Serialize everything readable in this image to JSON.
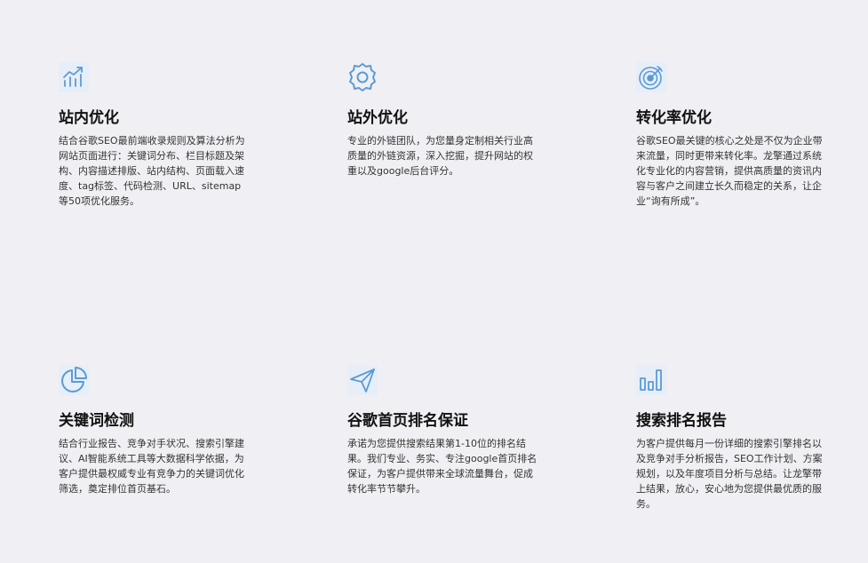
{
  "colors": {
    "background": "#f0f0f4",
    "icon_blue": "#5b9bd5",
    "icon_bg": "#e6eef8"
  },
  "cards": [
    {
      "icon": "trend-chart-icon",
      "title": "站内优化",
      "desc": "结合谷歌SEO最前端收录规则及算法分析为网站页面进行：关键词分布、栏目标题及架构、内容描述排版、站内结构、页面载入速度、tag标签、代码检测、URL、sitemap等50项优化服务。"
    },
    {
      "icon": "gear-icon",
      "title": "站外优化",
      "desc": "专业的外链团队，为您量身定制相关行业高质量的外链资源，深入挖掘，提升网站的权重以及google后台评分。"
    },
    {
      "icon": "target-icon",
      "title": "转化率优化",
      "desc": "谷歌SEO最关键的核心之处是不仅为企业带来流量，同时更带来转化率。龙擎通过系统化专业化的内容营销，提供高质量的资讯内容与客户之间建立长久而稳定的关系，让企业“询有所成”。"
    },
    {
      "icon": "pie-chart-icon",
      "title": "关键词检测",
      "desc": "结合行业报告、竞争对手状况、搜索引擎建议、AI智能系统工具等大数据科学依据，为客户提供最权威专业有竞争力的关键词优化筛选，奠定排位首页基石。"
    },
    {
      "icon": "paper-plane-icon",
      "title": "谷歌首页排名保证",
      "desc": "承诺为您提供搜索结果第1-10位的排名结果。我们专业、务实、专注google首页排名保证，为客户提供带来全球流量舞台，促成转化率节节攀升。"
    },
    {
      "icon": "bar-chart-icon",
      "title": "搜索排名报告",
      "desc": "为客户提供每月一份详细的搜索引擎排名以及竞争对手分析报告，SEO工作计划、方案规划，以及年度项目分析与总结。让龙擎带上结果，放心，安心地为您提供最优质的服务。"
    }
  ]
}
